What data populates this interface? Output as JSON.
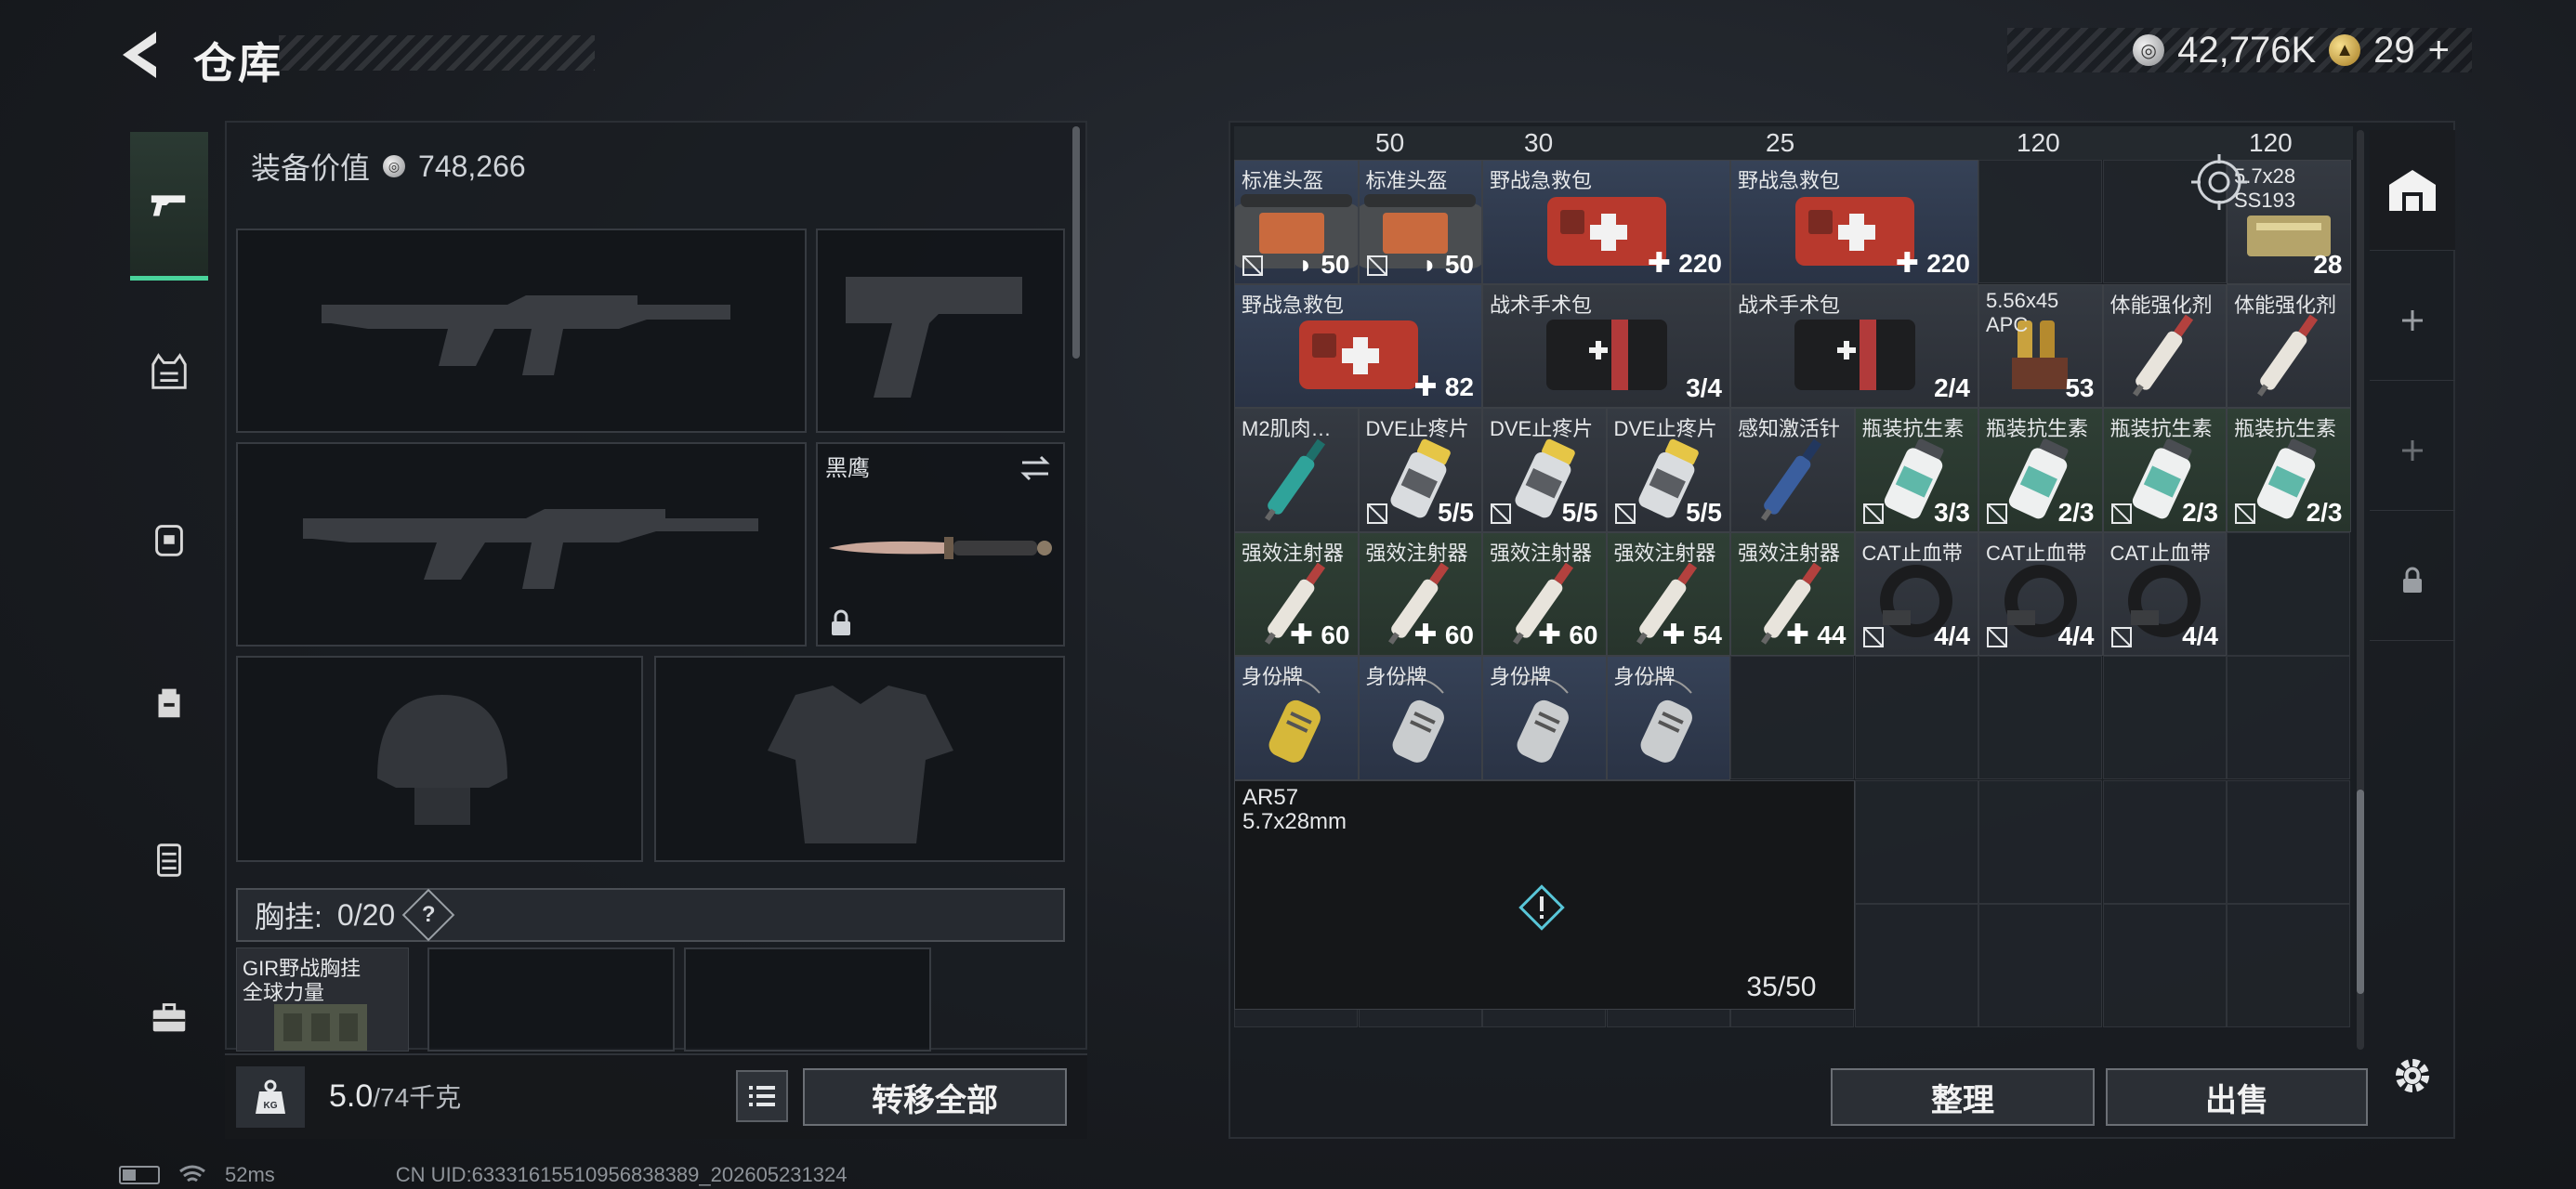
{
  "header": {
    "title": "仓库",
    "currency": [
      {
        "icon": "silver-coin-icon",
        "value": "42,776K"
      },
      {
        "icon": "gold-coin-icon",
        "value": "29"
      }
    ],
    "add_label": "+"
  },
  "nav": {
    "items": [
      {
        "icon": "pistol-icon",
        "active": true
      },
      {
        "icon": "vest-icon",
        "active": false
      },
      {
        "icon": "backpack-armor-icon",
        "active": false
      },
      {
        "icon": "bag-icon",
        "active": false
      },
      {
        "icon": "case-icon",
        "active": false
      },
      {
        "icon": "toolbox-icon",
        "active": false
      }
    ]
  },
  "equipment": {
    "value_label": "装备价值",
    "value": "748,266",
    "melee_label": "黑鹰",
    "chest_rig_label": "胸挂:",
    "chest_rig_count": "0/20",
    "help_label": "?",
    "rig_item_name": "GIR野战胸挂",
    "rig_item_sub": "全球力量",
    "weight_value": "5.0",
    "weight_max": "/74千克",
    "weight_icon_label": "KG",
    "transfer_all_label": "转移全部"
  },
  "stash": {
    "top_strip": [
      "50",
      "30",
      "25",
      "120",
      "120"
    ],
    "rows": [
      [
        {
          "name": "标准头盔",
          "qty": "50",
          "color": "blue",
          "art": "bag",
          "nosell": true,
          "shield": true
        },
        {
          "name": "标准头盔",
          "qty": "50",
          "color": "blue",
          "art": "bag",
          "nosell": true,
          "shield": true
        },
        {
          "name": "野战急救包",
          "qty": "220",
          "color": "blue",
          "art": "medkit",
          "plus": true,
          "span": 2
        },
        {
          "name": "野战急救包",
          "qty": "220",
          "color": "blue",
          "art": "medkit",
          "plus": true,
          "span": 2
        },
        {
          "name": "5.7x28\nSS193",
          "qty": "28",
          "color": "gray",
          "art": "ammo"
        }
      ],
      [
        {
          "name": "野战急救包",
          "qty": "82",
          "color": "blue",
          "art": "medkit",
          "plus": true,
          "span": 2
        },
        {
          "name": "战术手术包",
          "qty": "3/4",
          "color": "gray",
          "art": "surgkit",
          "span": 2
        },
        {
          "name": "战术手术包",
          "qty": "2/4",
          "color": "gray",
          "art": "surgkit",
          "span": 2
        },
        {
          "name": "5.56x45\nAPC",
          "qty": "53",
          "color": "gray",
          "art": "ammo2"
        },
        {
          "name": "体能强化剂",
          "qty": "",
          "color": "gray",
          "art": "syringe"
        },
        {
          "name": "体能强化剂",
          "qty": "",
          "color": "gray",
          "art": "syringe"
        }
      ],
      [
        {
          "name": "M2肌肉…",
          "qty": "",
          "color": "gray",
          "art": "syringe-teal"
        },
        {
          "name": "DVE止疼片",
          "qty": "5/5",
          "color": "gray",
          "art": "pills",
          "nosell": true
        },
        {
          "name": "DVE止疼片",
          "qty": "5/5",
          "color": "gray",
          "art": "pills",
          "nosell": true
        },
        {
          "name": "DVE止疼片",
          "qty": "5/5",
          "color": "gray",
          "art": "pills",
          "nosell": true
        },
        {
          "name": "感知激活针",
          "qty": "",
          "color": "gray",
          "art": "syringe-blue"
        },
        {
          "name": "瓶装抗生素",
          "qty": "3/3",
          "color": "green",
          "art": "bottle",
          "nosell": true
        },
        {
          "name": "瓶装抗生素",
          "qty": "2/3",
          "color": "green",
          "art": "bottle",
          "nosell": true
        },
        {
          "name": "瓶装抗生素",
          "qty": "2/3",
          "color": "green",
          "art": "bottle",
          "nosell": true
        },
        {
          "name": "瓶装抗生素",
          "qty": "2/3",
          "color": "green",
          "art": "bottle",
          "nosell": true
        }
      ],
      [
        {
          "name": "强效注射器",
          "qty": "60",
          "color": "green",
          "art": "syringe",
          "plus": true
        },
        {
          "name": "强效注射器",
          "qty": "60",
          "color": "green",
          "art": "syringe",
          "plus": true
        },
        {
          "name": "强效注射器",
          "qty": "60",
          "color": "green",
          "art": "syringe",
          "plus": true
        },
        {
          "name": "强效注射器",
          "qty": "54",
          "color": "green",
          "art": "syringe",
          "plus": true
        },
        {
          "name": "强效注射器",
          "qty": "44",
          "color": "green",
          "art": "syringe",
          "plus": true
        },
        {
          "name": "CAT止血带",
          "qty": "4/4",
          "color": "gray",
          "art": "tourniquet",
          "nosell": true
        },
        {
          "name": "CAT止血带",
          "qty": "4/4",
          "color": "gray",
          "art": "tourniquet",
          "nosell": true
        },
        {
          "name": "CAT止血带",
          "qty": "4/4",
          "color": "gray",
          "art": "tourniquet",
          "nosell": true
        }
      ],
      [
        {
          "name": "身份牌",
          "qty": "",
          "color": "blue",
          "art": "tag-gold"
        },
        {
          "name": "身份牌",
          "qty": "",
          "color": "blue",
          "art": "tag"
        },
        {
          "name": "身份牌",
          "qty": "",
          "color": "blue",
          "art": "tag"
        },
        {
          "name": "身份牌",
          "qty": "",
          "color": "blue",
          "art": "tag"
        }
      ]
    ],
    "container": {
      "name": "AR57",
      "sub": "5.7x28mm",
      "count": "35/50"
    },
    "sort_label": "整理",
    "sell_label": "出售"
  },
  "rail": {
    "items": [
      "stash-icon",
      "add-icon",
      "add-icon",
      "lock-icon"
    ]
  },
  "status": {
    "ping": "52ms",
    "uid": "CN UID:6333161551095683838​9_202605231324"
  },
  "colors": {
    "accent_green": "#49d39b",
    "item_blue": "#364257",
    "item_green": "#2f3f35"
  }
}
